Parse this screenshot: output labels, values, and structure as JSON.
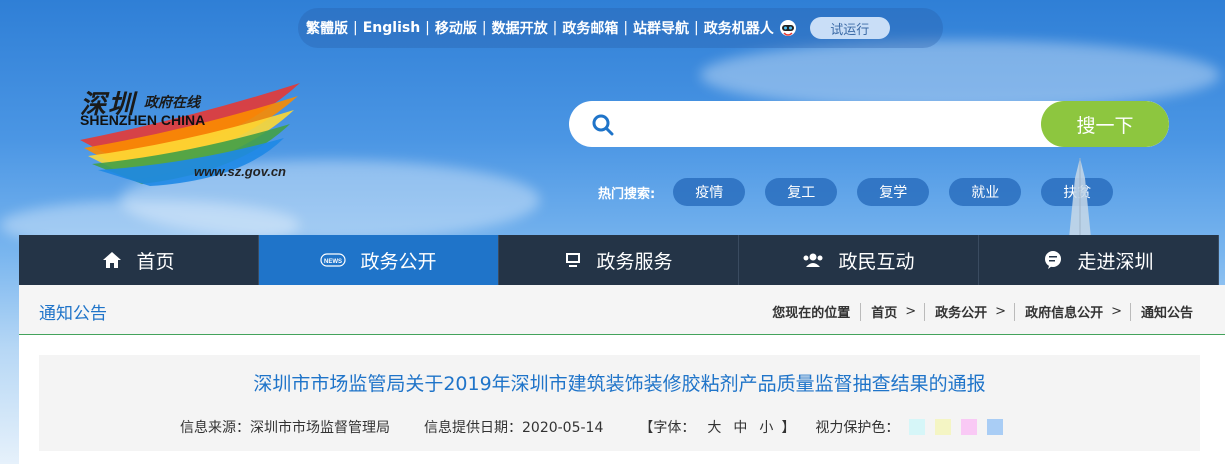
{
  "topbar": {
    "links": [
      "繁體版",
      "English",
      "移动版",
      "数据开放",
      "政务邮箱",
      "站群导航",
      "政务机器人"
    ],
    "trial_label": "试运行"
  },
  "logo": {
    "cn": "深圳",
    "cn2": "政府在线",
    "en": "SHENZHEN  CHINA",
    "url": "www.sz.gov.cn"
  },
  "search": {
    "placeholder": "",
    "button_label": "搜一下"
  },
  "hot": {
    "label": "热门搜索:",
    "tags": [
      "疫情",
      "复工",
      "复学",
      "就业",
      "扶贫"
    ]
  },
  "nav": {
    "items": [
      {
        "label": "首页",
        "icon": "home-icon"
      },
      {
        "label": "政务公开",
        "icon": "news-icon"
      },
      {
        "label": "政务服务",
        "icon": "monitor-icon"
      },
      {
        "label": "政民互动",
        "icon": "people-icon"
      },
      {
        "label": "走进深圳",
        "icon": "chat-icon"
      }
    ],
    "active_index": 1
  },
  "crumbbar": {
    "title": "通知公告",
    "location_label": "您现在的位置",
    "path": [
      "首页",
      "政务公开",
      "政府信息公开",
      "通知公告"
    ],
    "separator": ">"
  },
  "article": {
    "title": "深圳市市场监管局关于2019年深圳市建筑装饰装修胶粘剂产品质量监督抽查结果的通报",
    "source": "信息来源：深圳市市场监督管理局",
    "date": "信息提供日期：2020-05-14",
    "font_open": "【字体：",
    "font_large": "大",
    "font_mid": "中",
    "font_small": "小",
    "font_close": "】",
    "eye_label": "视力保护色：",
    "swatches": [
      "#d6f6f8",
      "#f4f5c4",
      "#f9c9f5",
      "#a9cdf5"
    ]
  },
  "colors": {
    "nav_bg": "#243447",
    "nav_active": "#1f74c9",
    "search_button": "#8dc63f",
    "link_blue": "#1f74c9"
  }
}
